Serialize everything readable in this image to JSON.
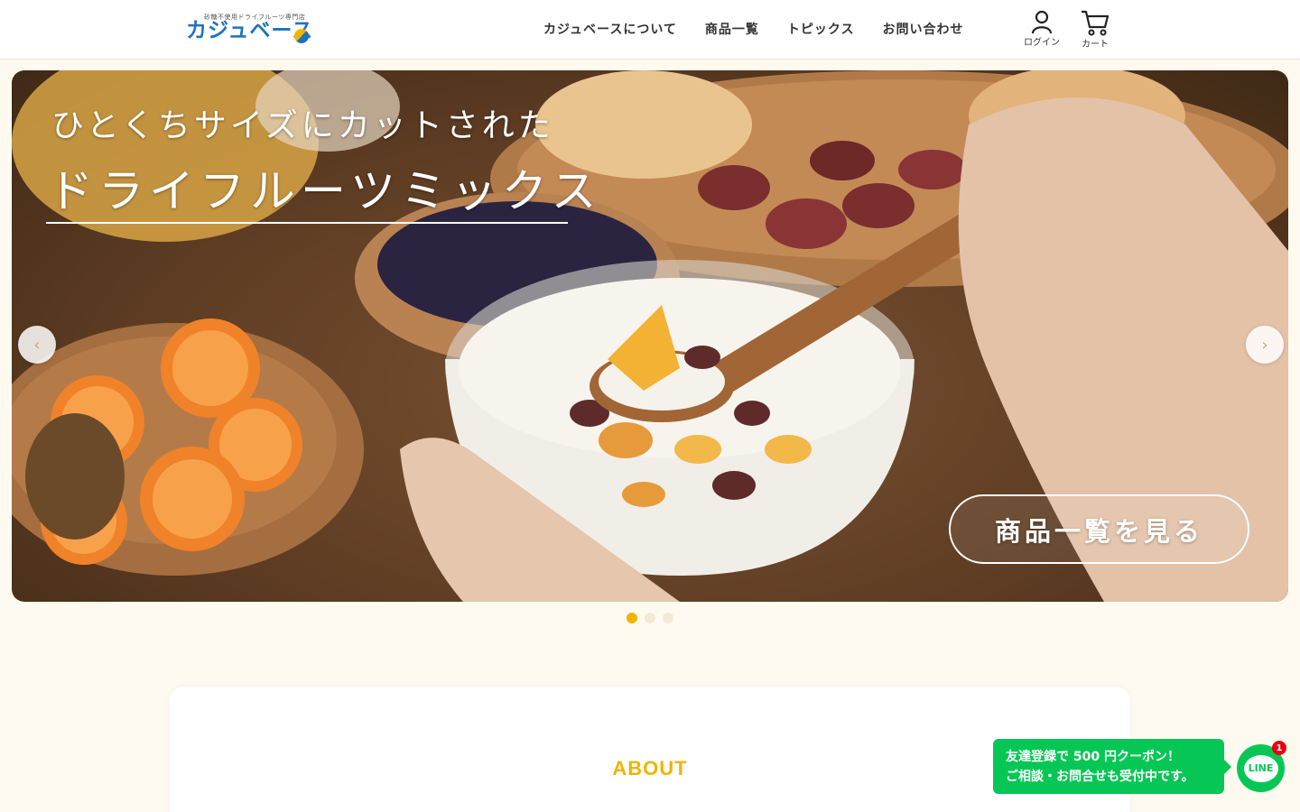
{
  "header": {
    "logo_sub": "砂糖不使用ドライフルーツ専門店",
    "logo_main": "カジュベース",
    "nav": [
      "カジュベースについて",
      "商品一覧",
      "トピックス",
      "お問い合わせ"
    ],
    "login_label": "ログイン",
    "cart_label": "カート"
  },
  "hero": {
    "line1": "ひとくちサイズにカットされた",
    "line2": "ドライフルーツミックス",
    "cta": "商品一覧を見る",
    "prev_icon": "chevron-left-icon",
    "next_icon": "chevron-right-icon",
    "slide_count": 3,
    "active_slide": 1
  },
  "about": {
    "title": "ABOUT"
  },
  "line_widget": {
    "line1": "友達登録で 500 円クーポン！",
    "line2": "ご相談・お問合せも受付中です。",
    "button_text": "LINE",
    "badge": "1"
  },
  "colors": {
    "accent": "#f0b400",
    "brand_blue": "#1e73be",
    "line_green": "#06c755",
    "page_bg": "#fffaf0"
  }
}
